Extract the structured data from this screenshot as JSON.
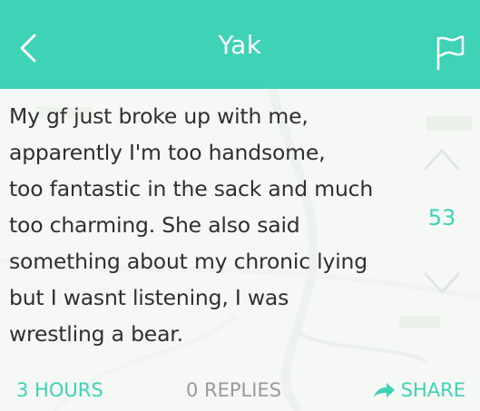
{
  "header": {
    "title": "Yak",
    "back_icon": "chevron-left-icon",
    "flag_icon": "flag-icon",
    "color": "#3ed3b6"
  },
  "post": {
    "message_lines": [
      "My gf just broke up with me,",
      "apparently I'm too handsome,",
      "too fantastic in the sack and much",
      "too charming. She also said",
      "something about my chronic lying",
      "but I wasnt listening, I was",
      "wrestling a bear."
    ],
    "vote_count": "53",
    "upvote_icon": "chevron-up-icon",
    "downvote_icon": "chevron-down-icon"
  },
  "footer": {
    "time": "3 HOURS",
    "replies": "0 REPLIES",
    "share": "SHARE",
    "share_icon": "share-arrow-icon"
  }
}
